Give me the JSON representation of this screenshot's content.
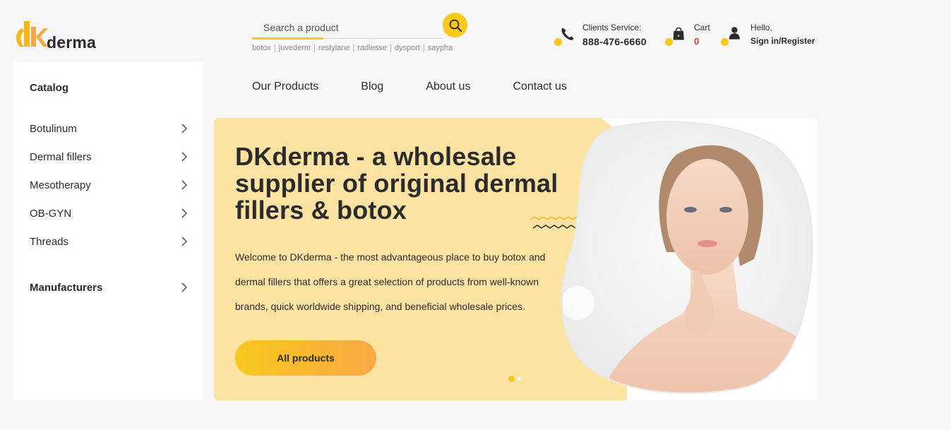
{
  "brand": {
    "logo_text": "DKderma",
    "word": "derma"
  },
  "search": {
    "placeholder": "Search a product",
    "tags": [
      "botox",
      "juvederm",
      "restylane",
      "radiesse",
      "dysport",
      "saypha"
    ]
  },
  "header": {
    "phone": {
      "label": "Clients Service:",
      "number": "888-476-6660",
      "icon": "phone-icon"
    },
    "cart": {
      "label": "Cart",
      "count": "0",
      "icon": "shopping-bag-icon"
    },
    "user": {
      "label": "Hello,",
      "action": "Sign in/Register",
      "icon": "user-icon"
    }
  },
  "sidebar": {
    "title": "Catalog",
    "items": [
      {
        "label": "Botulinum"
      },
      {
        "label": "Dermal fillers"
      },
      {
        "label": "Mesotherapy"
      },
      {
        "label": "OB-GYN"
      },
      {
        "label": "Threads"
      }
    ],
    "manufacturers": "Manufacturers"
  },
  "nav": [
    "Our Products",
    "Blog",
    "About us",
    "Contact us"
  ],
  "hero": {
    "title": "DKderma - a wholesale supplier of original dermal fillers & botox",
    "text": "Welcome to DKderma - the most advantageous place to buy botox and dermal fillers that offers a great selection of products from well-known brands, quick worldwide shipping, and beneficial wholesale prices.",
    "button": "All products",
    "slides": 2,
    "active_slide": 1
  },
  "colors": {
    "accent": "#f8c81c",
    "accent_orange": "#f8a944",
    "hero_bg": "#fde3a2",
    "cart_count": "#e03a1e",
    "page_bg": "#f7f7f7",
    "text": "#2b2b2b"
  }
}
